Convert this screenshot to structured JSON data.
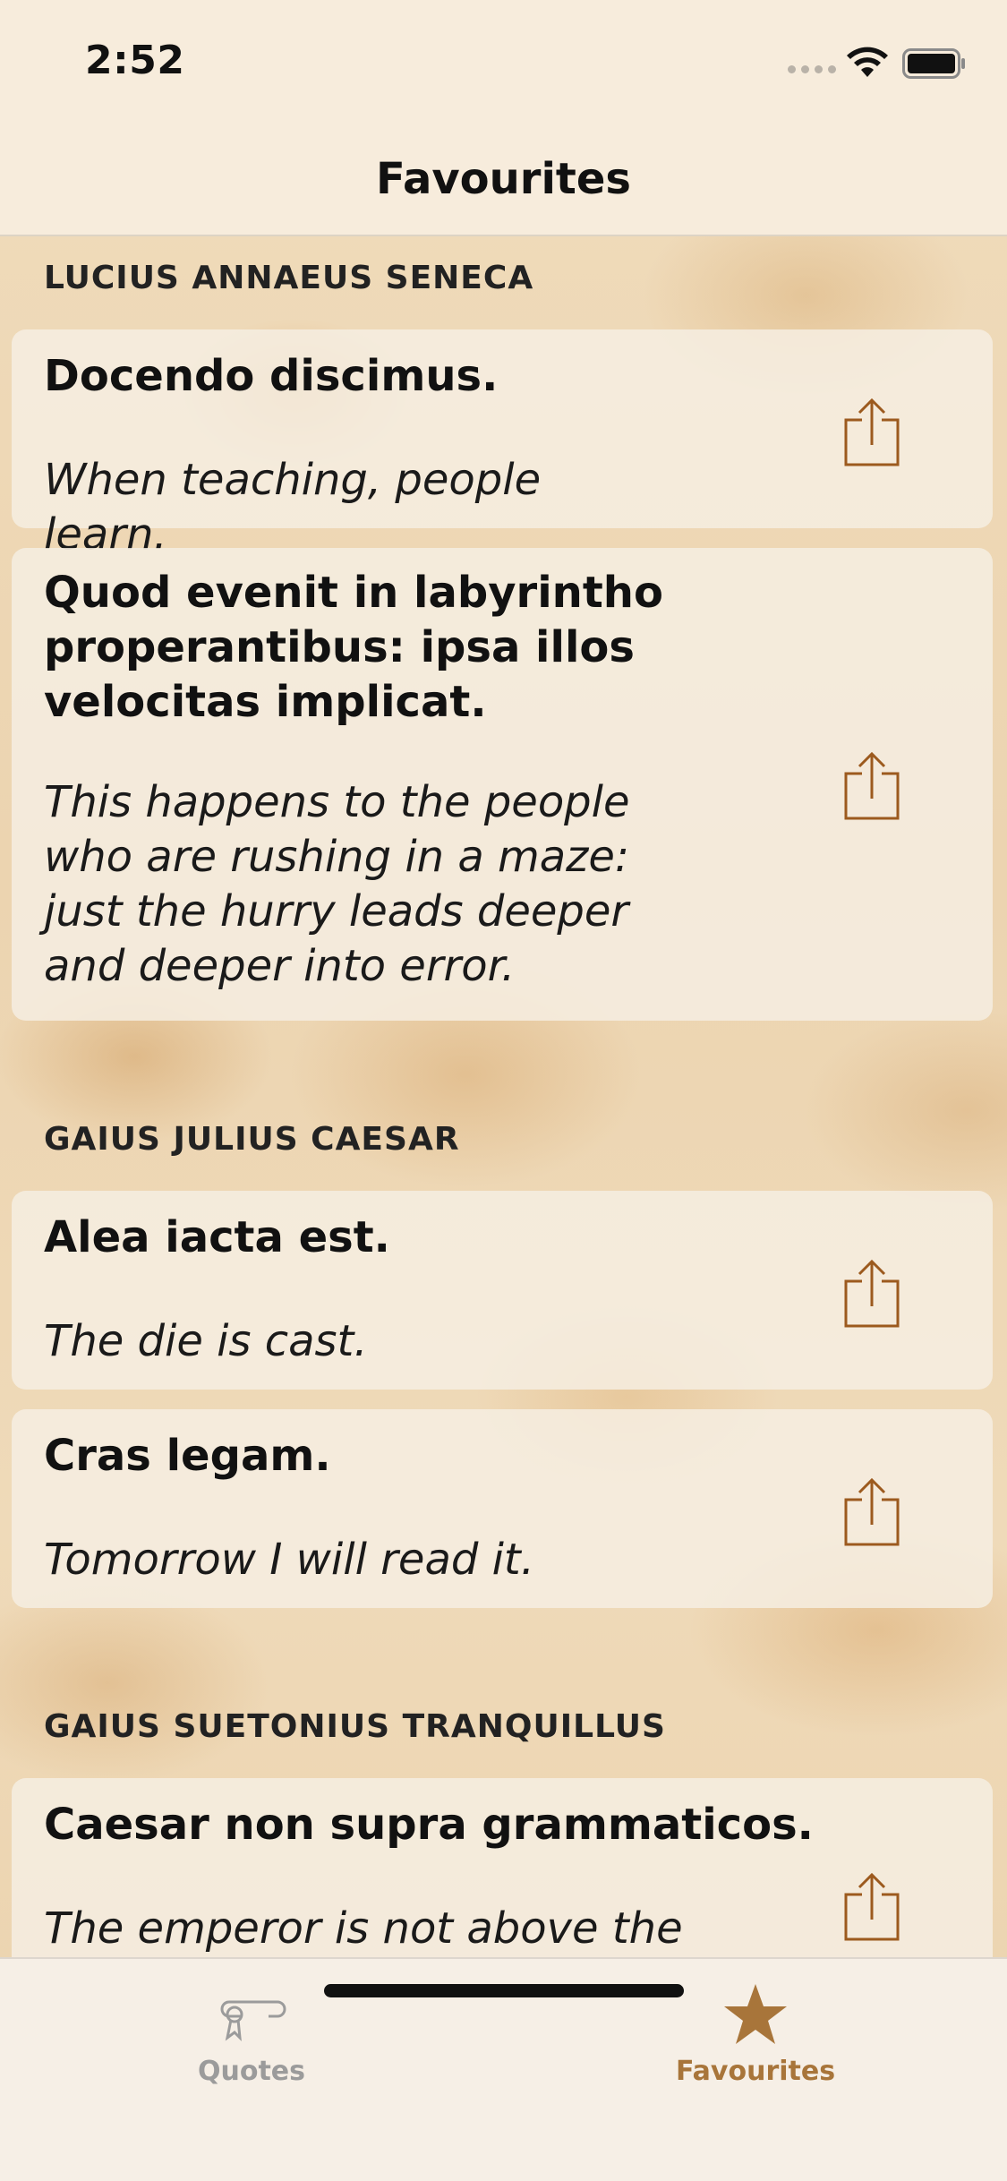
{
  "status_bar": {
    "time": "2:52"
  },
  "nav": {
    "title": "Favourites"
  },
  "sections": [
    {
      "author": "LUCIUS ANNAEUS SENECA",
      "quotes": [
        {
          "latin": "Docendo discimus.",
          "translation": "When teaching, people learn."
        },
        {
          "latin": "Quod evenit in labyrintho properantibus: ipsa illos velocitas implicat.",
          "translation": "This happens to the people who are rushing in a maze: just the hurry leads deeper and deeper into error."
        }
      ]
    },
    {
      "author": "GAIUS JULIUS CAESAR",
      "quotes": [
        {
          "latin": "Alea iacta est.",
          "translation": "The die is cast."
        },
        {
          "latin": "Cras legam.",
          "translation": "Tomorrow I will read it."
        }
      ]
    },
    {
      "author": "GAIUS SUETONIUS TRANQUILLUS",
      "quotes": [
        {
          "latin": "Caesar non supra grammaticos.",
          "translation": "The emperor is not above the"
        }
      ]
    }
  ],
  "tab_bar": {
    "tabs": [
      {
        "label": "Quotes",
        "icon": "scroll-icon",
        "selected": false
      },
      {
        "label": "Favourites",
        "icon": "star-icon",
        "selected": true
      }
    ]
  },
  "colors": {
    "accent": "#a8753a",
    "share_icon": "#9c5a1e",
    "inactive_tab": "#9b9b9b"
  }
}
